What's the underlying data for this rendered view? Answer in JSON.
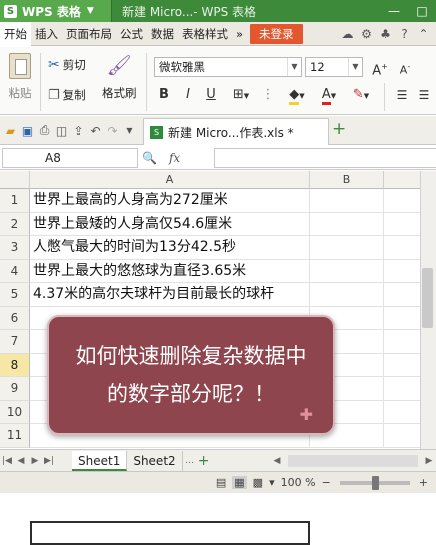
{
  "titlebar": {
    "app_name": "WPS 表格",
    "doc_title": "新建 Micro...- WPS 表格"
  },
  "menu": {
    "items": [
      "开始",
      "插入",
      "页面布局",
      "公式",
      "数据",
      "表格样式"
    ],
    "login": "未登录"
  },
  "ribbon": {
    "paste": "粘贴",
    "cut": "剪切",
    "copy": "复制",
    "format_painter": "格式刷",
    "font_name": "微软雅黑",
    "font_size": "12",
    "bold": "B",
    "italic": "I",
    "underline": "U",
    "font_grow": "A",
    "font_shrink": "A",
    "font_color_label": "A"
  },
  "doc_tab": {
    "label": "新建 Micro...作表.xls *"
  },
  "formula_bar": {
    "cell_ref": "A8",
    "fx": "fx",
    "content": ""
  },
  "grid": {
    "columns": [
      "A",
      "B"
    ],
    "rows": [
      {
        "n": "1",
        "a": "世界上最高的人身高为272厘米"
      },
      {
        "n": "2",
        "a": "世界上最矮的人身高仅54.6厘米"
      },
      {
        "n": "3",
        "a": "人憋气最大的时间为13分42.5秒"
      },
      {
        "n": "4",
        "a": "世界上最大的悠悠球为直径3.65米"
      },
      {
        "n": "5",
        "a": "4.37米的高尔夫球杆为目前最长的球杆"
      },
      {
        "n": "6",
        "a": ""
      },
      {
        "n": "7",
        "a": ""
      },
      {
        "n": "8",
        "a": ""
      },
      {
        "n": "9",
        "a": ""
      },
      {
        "n": "10",
        "a": ""
      },
      {
        "n": "11",
        "a": ""
      }
    ],
    "selected_row": "8"
  },
  "sheets": [
    "Sheet1",
    "Sheet2"
  ],
  "status": {
    "zoom": "100 %",
    "zoom_level_pct": 100
  },
  "overlay": {
    "line1": "如何快速删除复杂数据中",
    "line2": "的数字部分呢？！"
  },
  "colors": {
    "brand_green": "#3d8a3a",
    "login_orange": "#e2572d",
    "overlay_bg": "#8e454e"
  }
}
